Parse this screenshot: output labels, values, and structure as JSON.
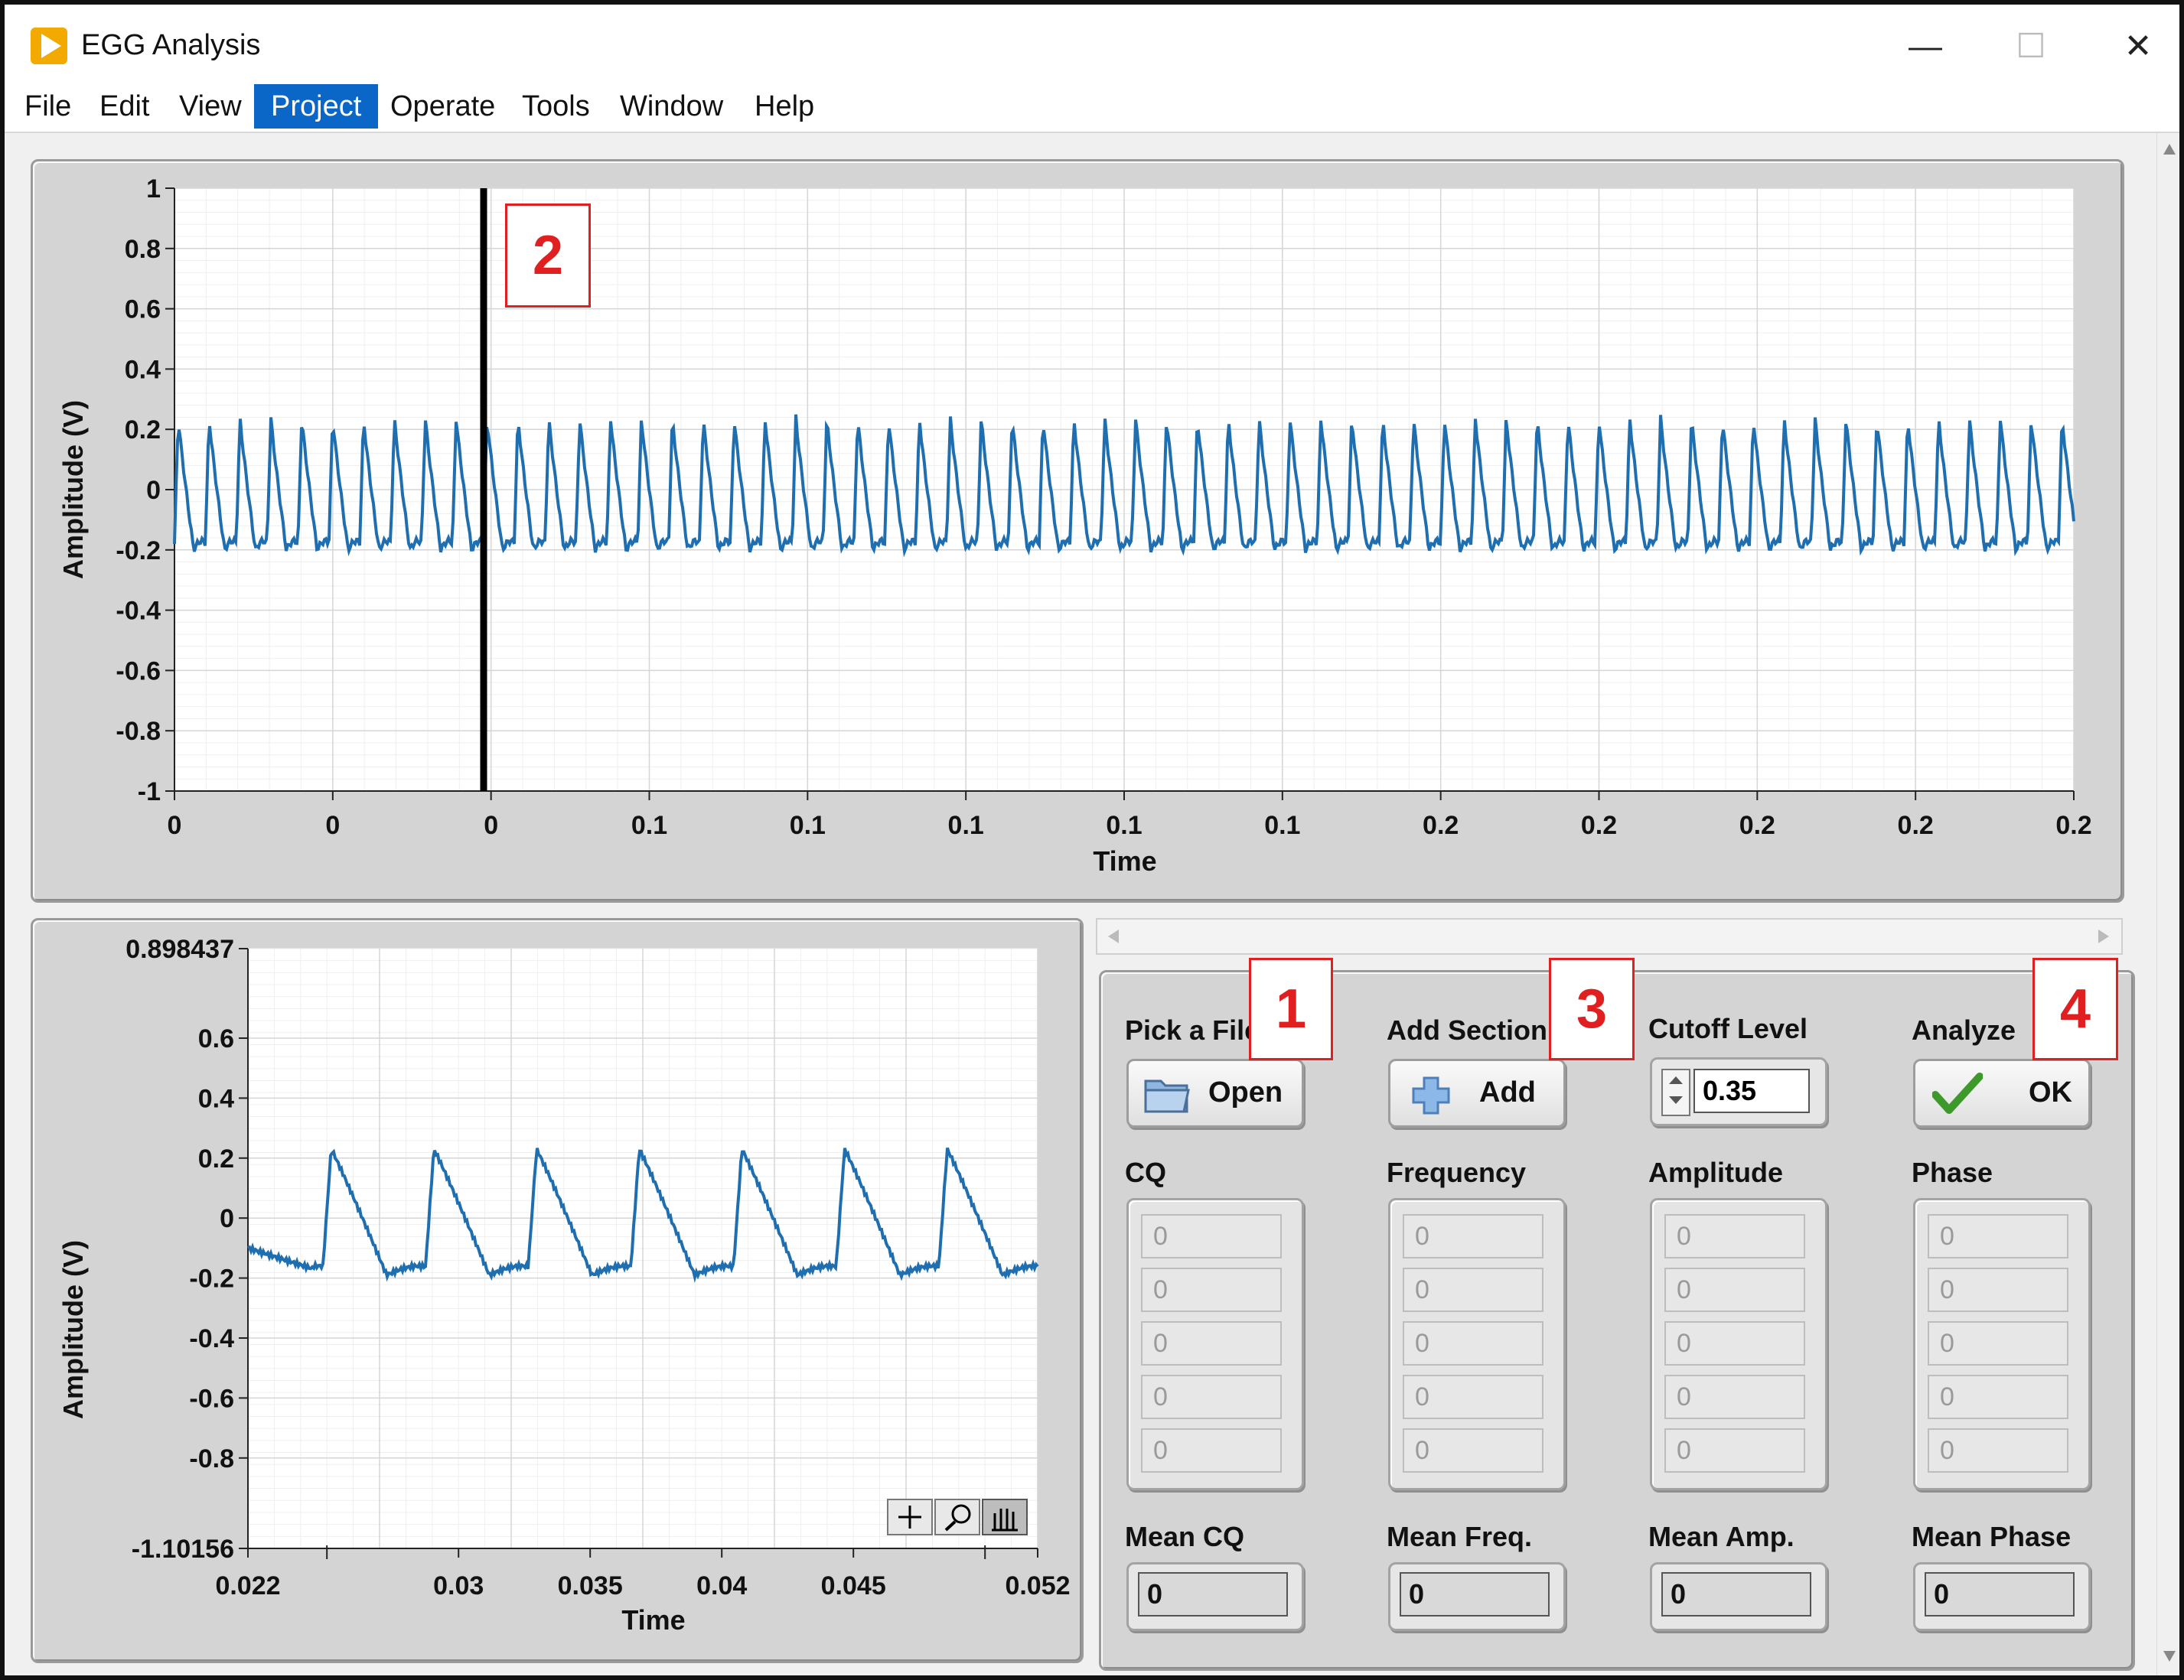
{
  "window": {
    "title": "EGG Analysis",
    "minimize": "—",
    "maximize": "☐",
    "close": "✕"
  },
  "menu": [
    "File",
    "Edit",
    "View",
    "Project",
    "Operate",
    "Tools",
    "Window",
    "Help"
  ],
  "menu_active": "Project",
  "top_chart": {
    "xlabel": "Time",
    "ylabel": "Amplitude (V)",
    "yticks": [
      "1",
      "0.8",
      "0.6",
      "0.4",
      "0.2",
      "0",
      "-0.2",
      "-0.4",
      "-0.6",
      "-0.8",
      "-1"
    ],
    "xticks": [
      "0",
      "0",
      "0",
      "0.1",
      "0.1",
      "0.1",
      "0.1",
      "0.1",
      "0.2",
      "0.2",
      "0.2",
      "0.2",
      "0.2"
    ]
  },
  "bottom_chart": {
    "xlabel": "Time",
    "ylabel": "Amplitude (V)",
    "yticks": [
      "0.898437",
      "0.6",
      "0.4",
      "0.2",
      "0",
      "-0.2",
      "-0.4",
      "-0.6",
      "-0.8",
      "-1.10156"
    ],
    "xticks": [
      "0.022",
      "0.03",
      "0.035",
      "0.04",
      "0.045",
      "0.052"
    ]
  },
  "controls": {
    "pick_file": {
      "label": "Pick a File",
      "button": "Open"
    },
    "add_section": {
      "label": "Add Section",
      "button": "Add"
    },
    "cutoff": {
      "label": "Cutoff Level",
      "value": "0.35"
    },
    "analyze": {
      "label": "Analyze",
      "button": "OK"
    }
  },
  "arrays": [
    {
      "label": "CQ",
      "values": [
        "0",
        "0",
        "0",
        "0",
        "0"
      ]
    },
    {
      "label": "Frequency",
      "values": [
        "0",
        "0",
        "0",
        "0",
        "0"
      ]
    },
    {
      "label": "Amplitude",
      "values": [
        "0",
        "0",
        "0",
        "0",
        "0"
      ]
    },
    {
      "label": "Phase",
      "values": [
        "0",
        "0",
        "0",
        "0",
        "0"
      ]
    }
  ],
  "means": [
    {
      "label": "Mean CQ",
      "value": "0"
    },
    {
      "label": "Mean Freq.",
      "value": "0"
    },
    {
      "label": "Mean Amp.",
      "value": "0"
    },
    {
      "label": "Mean Phase",
      "value": "0"
    }
  ],
  "annotations": [
    "1",
    "2",
    "3",
    "4"
  ],
  "colors": {
    "trace": "#1f6fb0",
    "menu_active": "#0a66c7",
    "annotation": "#e02020",
    "cursor": "#000000"
  }
}
